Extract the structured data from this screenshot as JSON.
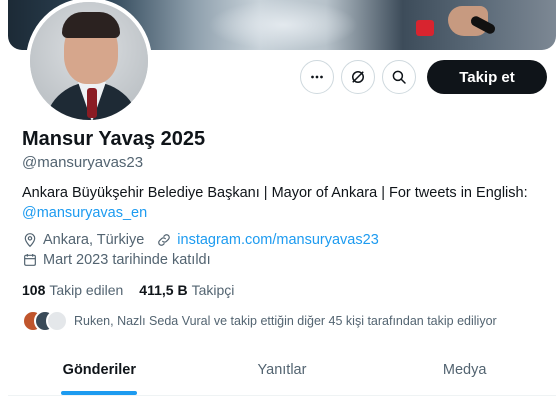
{
  "profile": {
    "display_name": "Mansur Yavaş 2025",
    "handle": "@mansuryavas23",
    "bio_text": "Ankara Büyükşehir Belediye Başkanı | Mayor of Ankara | For tweets in English:",
    "bio_mention": "@mansuryavas_en",
    "location": "Ankara, Türkiye",
    "website": "instagram.com/mansuryavas23",
    "joined": "Mart 2023 tarihinde katıldı"
  },
  "actions": {
    "more_icon": "more-dots-icon",
    "grok_icon": "grok-icon",
    "search_icon": "search-icon",
    "follow_label": "Takip et"
  },
  "stats": {
    "following_count": "108",
    "following_label": "Takip edilen",
    "followers_count": "411,5 B",
    "followers_label": "Takipçi"
  },
  "followed_by": {
    "text": "Ruken, Nazlı Seda Vural ve takip ettiğin diğer 45 kişi tarafından takip ediliyor"
  },
  "tabs": [
    {
      "label": "Gönderiler",
      "active": true
    },
    {
      "label": "Yanıtlar",
      "active": false
    },
    {
      "label": "Medya",
      "active": false
    }
  ],
  "colors": {
    "accent": "#1d9bf0",
    "primary_text": "#0f1419",
    "secondary_text": "#536471",
    "follow_button_bg": "#0f1419"
  }
}
